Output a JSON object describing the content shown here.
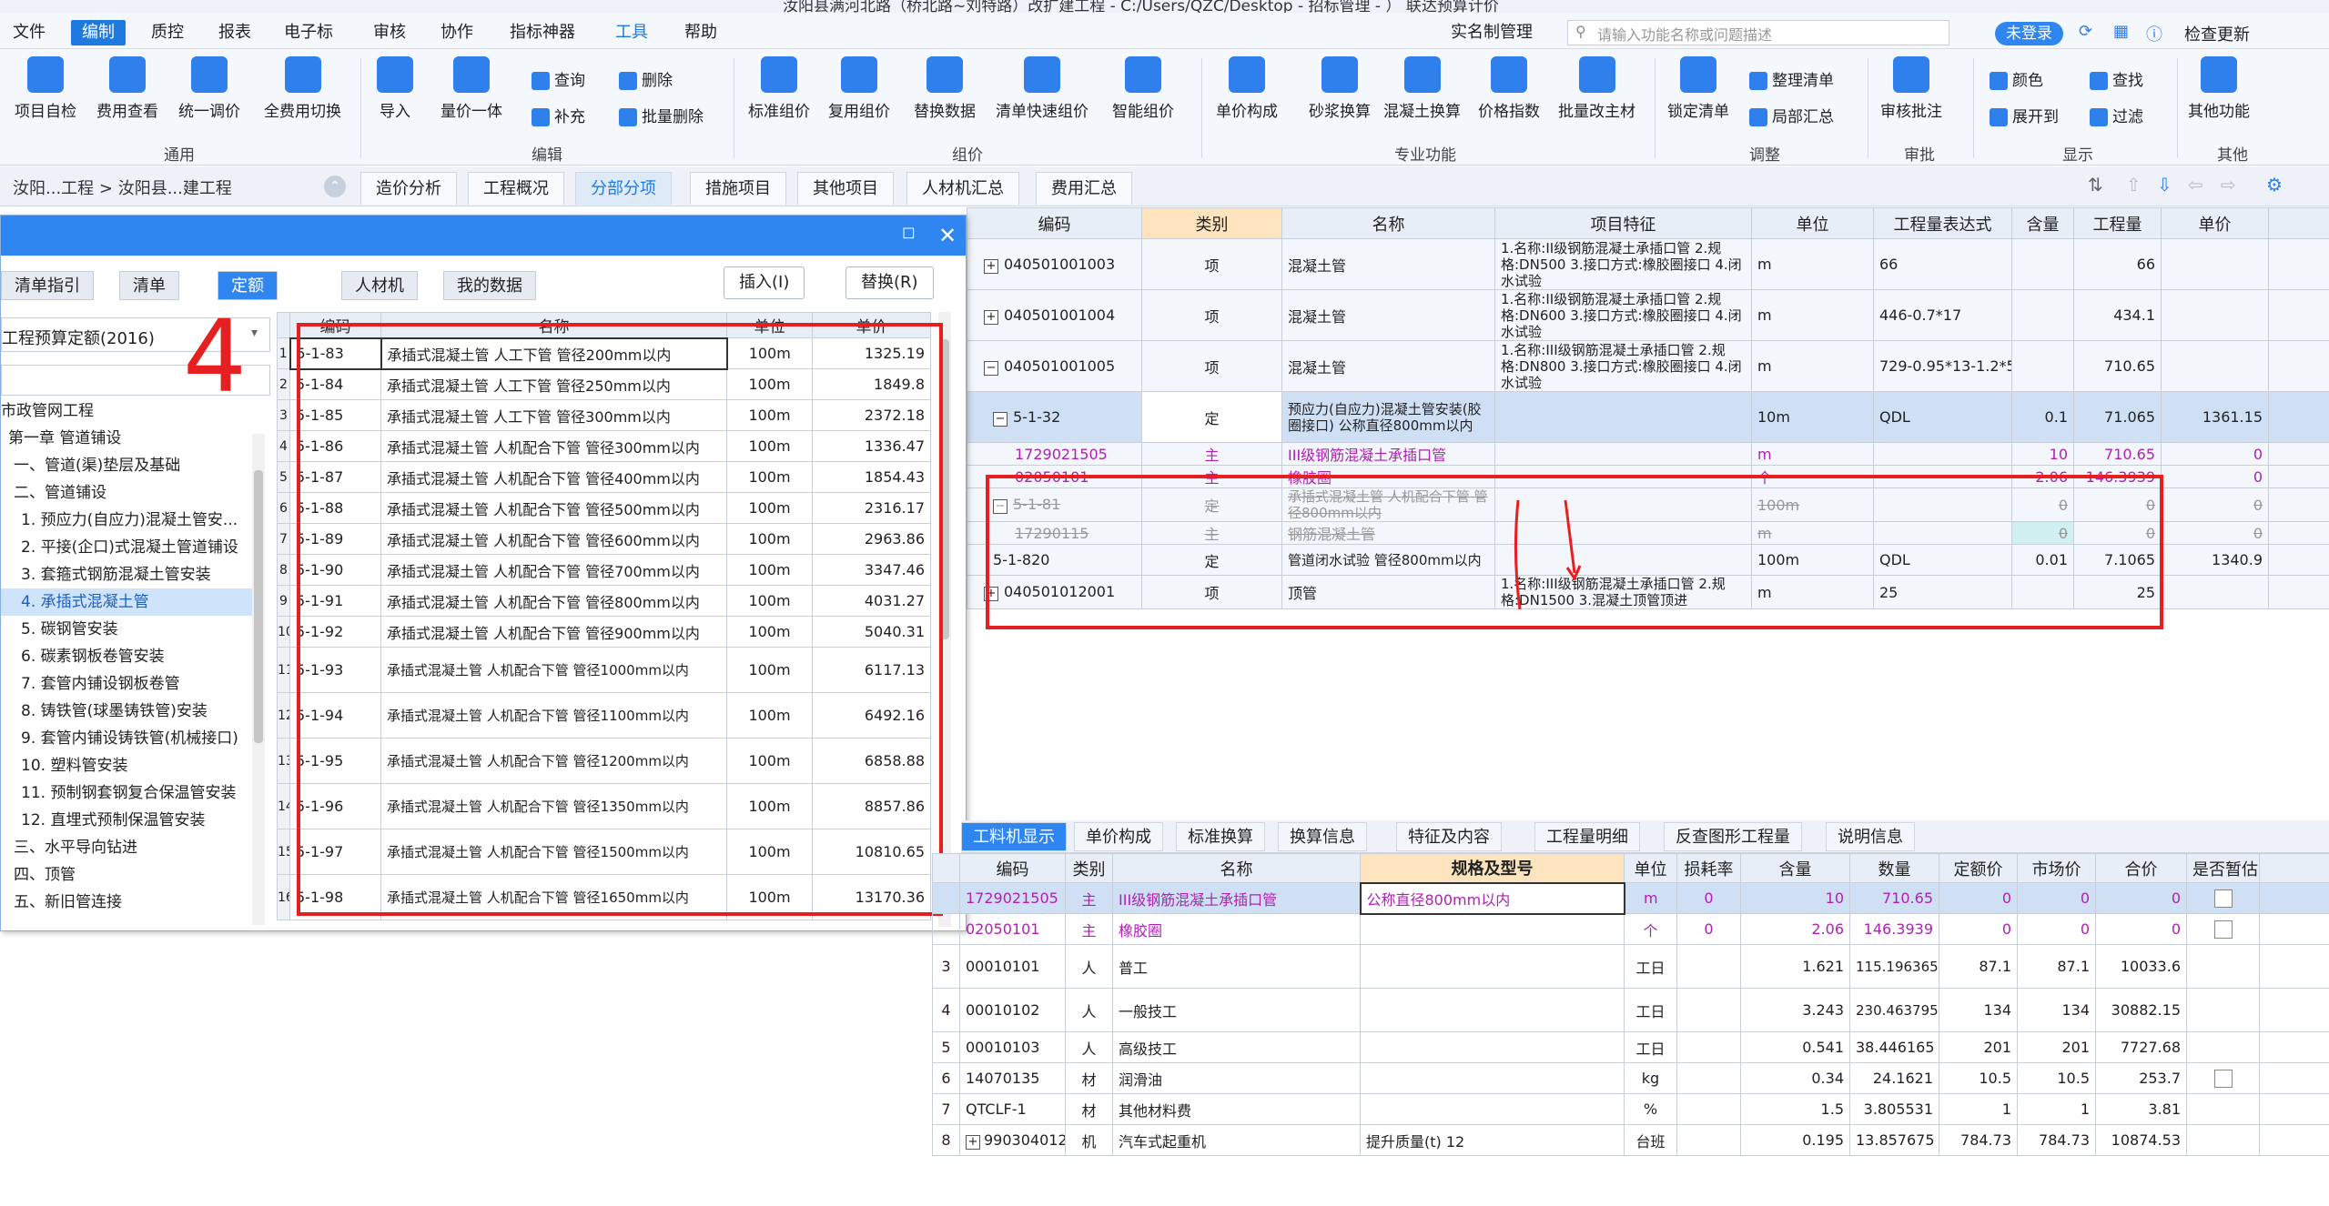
{
  "window": {
    "title": "汝阳县满河北路（桥北路~刘特路）改扩建工程 - C:/Users/QZC/Desktop - 招标管理 - ） 联达预算计价"
  },
  "menu": [
    "文件",
    "编制",
    "质控",
    "报表",
    "电子标",
    "审核",
    "协作",
    "指标神器",
    "工具",
    "帮助"
  ],
  "menu_right": {
    "realname": "实名制管理",
    "search_placeholder": "请输入功能名称或问题描述",
    "login": "未登录",
    "update": "检查更新"
  },
  "ribbon": {
    "buttons": [
      "项目自检",
      "费用查看",
      "统一调价",
      "全费用切换",
      "导入",
      "量价一体",
      "标准组价",
      "复用组价",
      "替换数据",
      "清单快速组价",
      "智能组价",
      "单价构成",
      "砂浆换算",
      "混凝土换算",
      "价格指数",
      "批量改主材",
      "锁定清单",
      "审核批注",
      "其他功能"
    ],
    "small": [
      "查询",
      "删除",
      "补充",
      "批量删除",
      "整理清单",
      "局部汇总",
      "颜色",
      "查找",
      "展开到",
      "过滤"
    ],
    "groups": [
      "通用",
      "编辑",
      "组价",
      "专业功能",
      "调整",
      "审批",
      "显示",
      "其他"
    ]
  },
  "nav": {
    "breadcrumb": "汝阳...工程 > 汝阳县...建工程",
    "tabs": [
      "造价分析",
      "工程概况",
      "分部分项",
      "措施项目",
      "其他项目",
      "人材机汇总",
      "费用汇总"
    ],
    "active_tab": "分部分项"
  },
  "main_table": {
    "headers": [
      "编码",
      "类别",
      "名称",
      "项目特征",
      "单位",
      "工程量表达式",
      "含量",
      "工程量",
      "单价"
    ],
    "rows": [
      {
        "code": "040501001003",
        "type": "项",
        "name": "混凝土管",
        "feature": "1.名称:II级钢筋混凝土承插口管 2.规格:DN500 3.接口方式:橡胶圈接口 4.闭水试验",
        "unit": "m",
        "expr": "66",
        "content": "",
        "qty": "66",
        "price": ""
      },
      {
        "code": "040501001004",
        "type": "项",
        "name": "混凝土管",
        "feature": "1.名称:II级钢筋混凝土承插口管 2.规格:DN600 3.接口方式:橡胶圈接口 4.闭水试验",
        "unit": "m",
        "expr": "446-0.7*17",
        "content": "",
        "qty": "434.1",
        "price": ""
      },
      {
        "code": "040501001005",
        "type": "项",
        "name": "混凝土管",
        "feature": "1.名称:III级钢筋混凝土承插口管 2.规格:DN800 3.接口方式:橡胶圈接口 4.闭水试验",
        "unit": "m",
        "expr": "729-0.95*13-1.2*5",
        "content": "",
        "qty": "710.65",
        "price": ""
      },
      {
        "code": "5-1-32",
        "type": "定",
        "name": "预应力(自应力)混凝土管安装(胶圈接口) 公称直径800mm以内",
        "feature": "",
        "unit": "10m",
        "expr": "QDL",
        "content": "0.1",
        "qty": "71.065",
        "price": "1361.15"
      },
      {
        "code": "1729021505",
        "type": "主",
        "name": "III级钢筋混凝土承插口管",
        "feature": "",
        "unit": "m",
        "expr": "",
        "content": "10",
        "qty": "710.65",
        "price": "0"
      },
      {
        "code": "02050101",
        "type": "主",
        "name": "橡胶圈",
        "feature": "",
        "unit": "个",
        "expr": "",
        "content": "2.06",
        "qty": "146.3939",
        "price": "0"
      },
      {
        "code": "5-1-81",
        "type": "定",
        "name": "承插式混凝土管 人机配合下管 管径800mm以内",
        "feature": "",
        "unit": "100m",
        "expr": "",
        "content": "0",
        "qty": "0",
        "price": "0"
      },
      {
        "code": "17290115",
        "type": "主",
        "name": "钢筋混凝土管",
        "feature": "",
        "unit": "m",
        "expr": "",
        "content": "0",
        "qty": "0",
        "price": "0"
      },
      {
        "code": "5-1-820",
        "type": "定",
        "name": "管道闭水试验 管径800mm以内",
        "feature": "",
        "unit": "100m",
        "expr": "QDL",
        "content": "0.01",
        "qty": "7.1065",
        "price": "1340.9"
      },
      {
        "code": "040501012001",
        "type": "项",
        "name": "顶管",
        "feature": "1.名称:III级钢筋混凝土承插口管 2.规格:DN1500 3.混凝土顶管顶进",
        "unit": "m",
        "expr": "25",
        "content": "",
        "qty": "25",
        "price": ""
      }
    ]
  },
  "dialog": {
    "tabs": [
      "清单指引",
      "清单",
      "定额",
      "人材机",
      "我的数据"
    ],
    "active_tab": "定额",
    "insert": "插入(I)",
    "replace": "替换(R)",
    "quota_lib": "工程预算定额(2016)",
    "annotation": "4",
    "tree": [
      "市政管网工程",
      "第一章 管道铺设",
      "一、管道(渠)垫层及基础",
      "二、管道铺设",
      "1. 预应力(自应力)混凝土管安...",
      "2. 平接(企口)式混凝土管道铺设",
      "3. 套箍式钢筋混凝土管安装",
      "4. 承插式混凝土管",
      "5. 碳钢管安装",
      "6. 碳素钢板卷管安装",
      "7. 套管内铺设钢板卷管",
      "8. 铸铁管(球墨铸铁管)安装",
      "9. 套管内铺设铸铁管(机械接口)",
      "10. 塑料管安装",
      "11. 预制钢套钢复合保温管安装",
      "12. 直埋式预制保温管安装",
      "三、水平导向钻进",
      "四、顶管",
      "五、新旧管连接"
    ],
    "selected_tree": "4. 承插式混凝土管",
    "table_headers": [
      "编码",
      "名称",
      "单位",
      "单价"
    ],
    "rows": [
      {
        "n": "1",
        "code": "5-1-83",
        "name": "承插式混凝土管 人工下管 管径200mm以内",
        "unit": "100m",
        "price": "1325.19"
      },
      {
        "n": "2",
        "code": "5-1-84",
        "name": "承插式混凝土管 人工下管 管径250mm以内",
        "unit": "100m",
        "price": "1849.8"
      },
      {
        "n": "3",
        "code": "5-1-85",
        "name": "承插式混凝土管 人工下管 管径300mm以内",
        "unit": "100m",
        "price": "2372.18"
      },
      {
        "n": "4",
        "code": "5-1-86",
        "name": "承插式混凝土管 人机配合下管 管径300mm以内",
        "unit": "100m",
        "price": "1336.47"
      },
      {
        "n": "5",
        "code": "5-1-87",
        "name": "承插式混凝土管 人机配合下管 管径400mm以内",
        "unit": "100m",
        "price": "1854.43"
      },
      {
        "n": "6",
        "code": "5-1-88",
        "name": "承插式混凝土管 人机配合下管 管径500mm以内",
        "unit": "100m",
        "price": "2316.17"
      },
      {
        "n": "7",
        "code": "5-1-89",
        "name": "承插式混凝土管 人机配合下管 管径600mm以内",
        "unit": "100m",
        "price": "2963.86"
      },
      {
        "n": "8",
        "code": "5-1-90",
        "name": "承插式混凝土管 人机配合下管 管径700mm以内",
        "unit": "100m",
        "price": "3347.46"
      },
      {
        "n": "9",
        "code": "5-1-91",
        "name": "承插式混凝土管 人机配合下管 管径800mm以内",
        "unit": "100m",
        "price": "4031.27"
      },
      {
        "n": "10",
        "code": "5-1-92",
        "name": "承插式混凝土管 人机配合下管 管径900mm以内",
        "unit": "100m",
        "price": "5040.31"
      },
      {
        "n": "11",
        "code": "5-1-93",
        "name": "承插式混凝土管 人机配合下管 管径1000mm以内",
        "unit": "100m",
        "price": "6117.13"
      },
      {
        "n": "12",
        "code": "5-1-94",
        "name": "承插式混凝土管 人机配合下管 管径1100mm以内",
        "unit": "100m",
        "price": "6492.16"
      },
      {
        "n": "13",
        "code": "5-1-95",
        "name": "承插式混凝土管 人机配合下管 管径1200mm以内",
        "unit": "100m",
        "price": "6858.88"
      },
      {
        "n": "14",
        "code": "5-1-96",
        "name": "承插式混凝土管 人机配合下管 管径1350mm以内",
        "unit": "100m",
        "price": "8857.86"
      },
      {
        "n": "15",
        "code": "5-1-97",
        "name": "承插式混凝土管 人机配合下管 管径1500mm以内",
        "unit": "100m",
        "price": "10810.65"
      },
      {
        "n": "16",
        "code": "5-1-98",
        "name": "承插式混凝土管 人机配合下管 管径1650mm以内",
        "unit": "100m",
        "price": "13170.36"
      }
    ]
  },
  "bottom": {
    "tabs": [
      "工料机显示",
      "单价构成",
      "标准换算",
      "换算信息",
      "特征及内容",
      "工程量明细",
      "反查图形工程量",
      "说明信息"
    ],
    "active_tab": "工料机显示",
    "headers": [
      "编码",
      "类别",
      "名称",
      "规格及型号",
      "单位",
      "损耗率",
      "含量",
      "数量",
      "定额价",
      "市场价",
      "合价",
      "是否暂估"
    ],
    "rows": [
      {
        "n": "",
        "code": "1729021505",
        "type": "主",
        "name": "III级钢筋混凝土承插口管",
        "spec": "公称直径800mm以内",
        "unit": "m",
        "loss": "0",
        "content": "10",
        "qty": "710.65",
        "quota": "0",
        "market": "0",
        "total": "0"
      },
      {
        "n": "",
        "code": "02050101",
        "type": "主",
        "name": "橡胶圈",
        "spec": "",
        "unit": "个",
        "loss": "0",
        "content": "2.06",
        "qty": "146.3939",
        "quota": "0",
        "market": "0",
        "total": "0"
      },
      {
        "n": "3",
        "code": "00010101",
        "type": "人",
        "name": "普工",
        "spec": "",
        "unit": "工日",
        "loss": "",
        "content": "1.621",
        "qty": "115.196365",
        "quota": "87.1",
        "market": "87.1",
        "total": "10033.6"
      },
      {
        "n": "4",
        "code": "00010102",
        "type": "人",
        "name": "一般技工",
        "spec": "",
        "unit": "工日",
        "loss": "",
        "content": "3.243",
        "qty": "230.463795",
        "quota": "134",
        "market": "134",
        "total": "30882.15"
      },
      {
        "n": "5",
        "code": "00010103",
        "type": "人",
        "name": "高级技工",
        "spec": "",
        "unit": "工日",
        "loss": "",
        "content": "0.541",
        "qty": "38.446165",
        "quota": "201",
        "market": "201",
        "total": "7727.68"
      },
      {
        "n": "6",
        "code": "14070135",
        "type": "材",
        "name": "润滑油",
        "spec": "",
        "unit": "kg",
        "loss": "",
        "content": "0.34",
        "qty": "24.1621",
        "quota": "10.5",
        "market": "10.5",
        "total": "253.7"
      },
      {
        "n": "7",
        "code": "QTCLF-1",
        "type": "材",
        "name": "其他材料费",
        "spec": "",
        "unit": "%",
        "loss": "",
        "content": "1.5",
        "qty": "3.805531",
        "quota": "1",
        "market": "1",
        "total": "3.81"
      },
      {
        "n": "8",
        "code": "990304012",
        "type": "机",
        "name": "汽车式起重机",
        "spec": "提升质量(t) 12",
        "unit": "台班",
        "loss": "",
        "content": "0.195",
        "qty": "13.857675",
        "quota": "784.73",
        "market": "784.73",
        "total": "10874.53"
      }
    ]
  }
}
